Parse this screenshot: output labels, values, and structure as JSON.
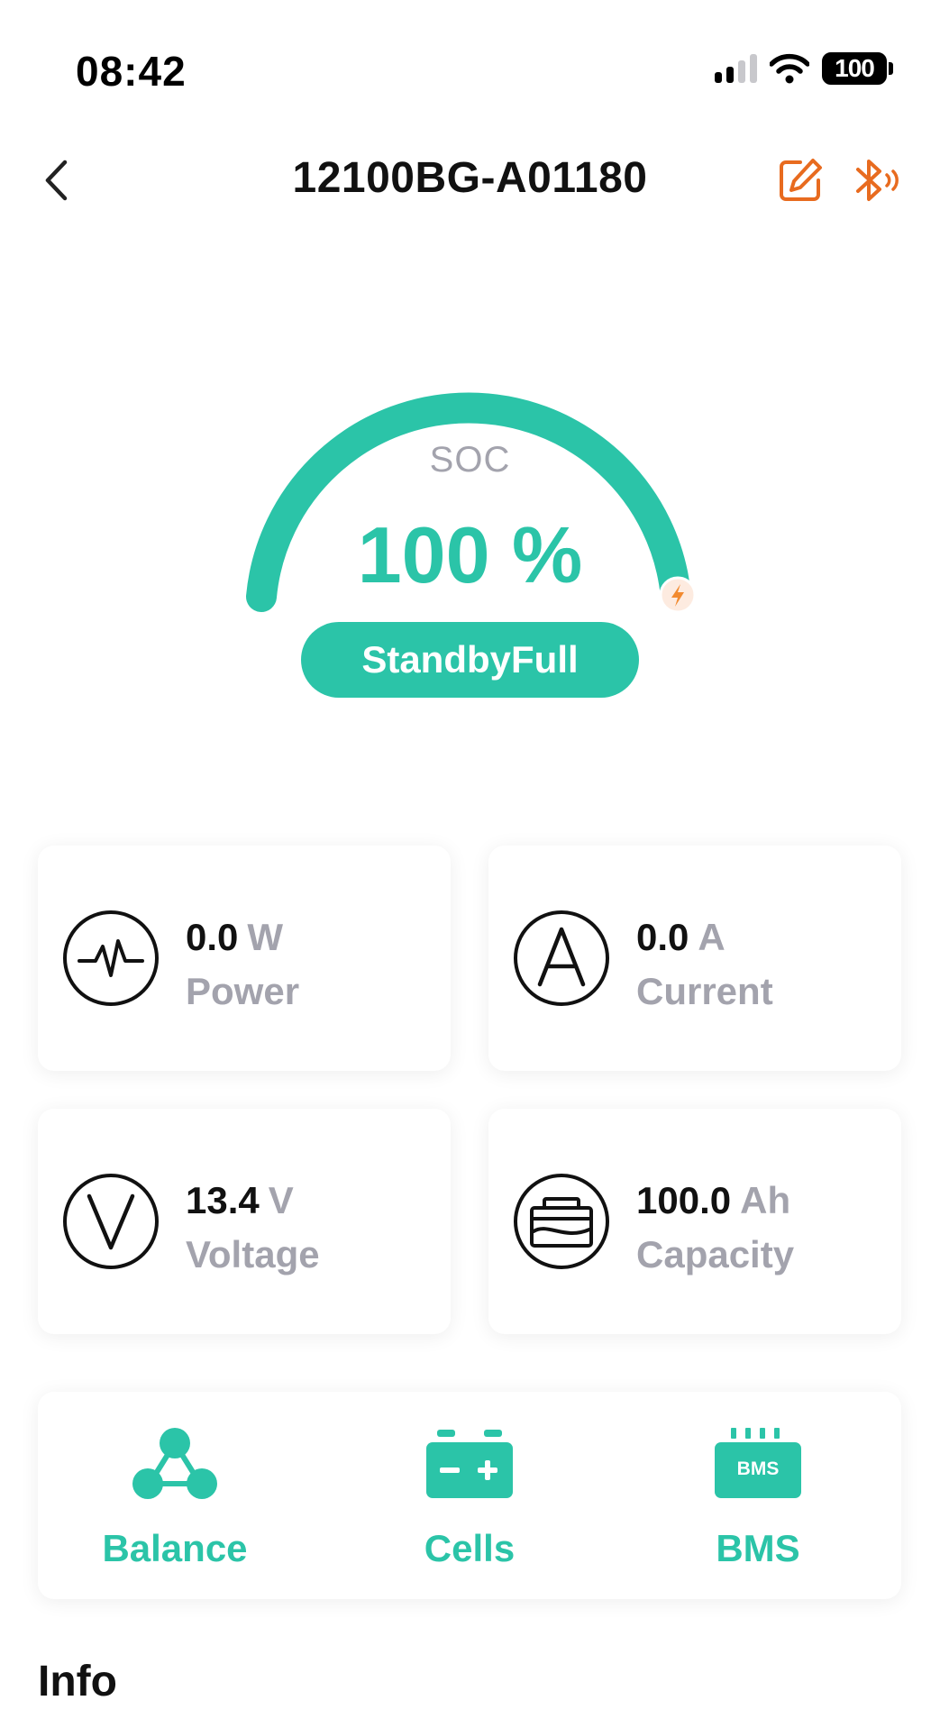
{
  "status_bar": {
    "time": "08:42",
    "battery_level": "100"
  },
  "header": {
    "title": "12100BG-A01180"
  },
  "gauge": {
    "label": "SOC",
    "value": "100 %",
    "percent": 100,
    "state": "StandbyFull"
  },
  "metrics": {
    "power": {
      "value": "0.0",
      "unit": "W",
      "label": "Power"
    },
    "current": {
      "value": "0.0",
      "unit": "A",
      "label": "Current"
    },
    "voltage": {
      "value": "13.4",
      "unit": "V",
      "label": "Voltage"
    },
    "capacity": {
      "value": "100.0",
      "unit": "Ah",
      "label": "Capacity"
    }
  },
  "nav": {
    "balance": {
      "label": "Balance"
    },
    "cells": {
      "label": "Cells"
    },
    "bms": {
      "label": "BMS",
      "icon_text": "BMS"
    }
  },
  "sections": {
    "info_title": "Info"
  },
  "colors": {
    "accent": "#2bc4a8",
    "orange": "#e86b1f",
    "muted": "#a3a3ad"
  }
}
